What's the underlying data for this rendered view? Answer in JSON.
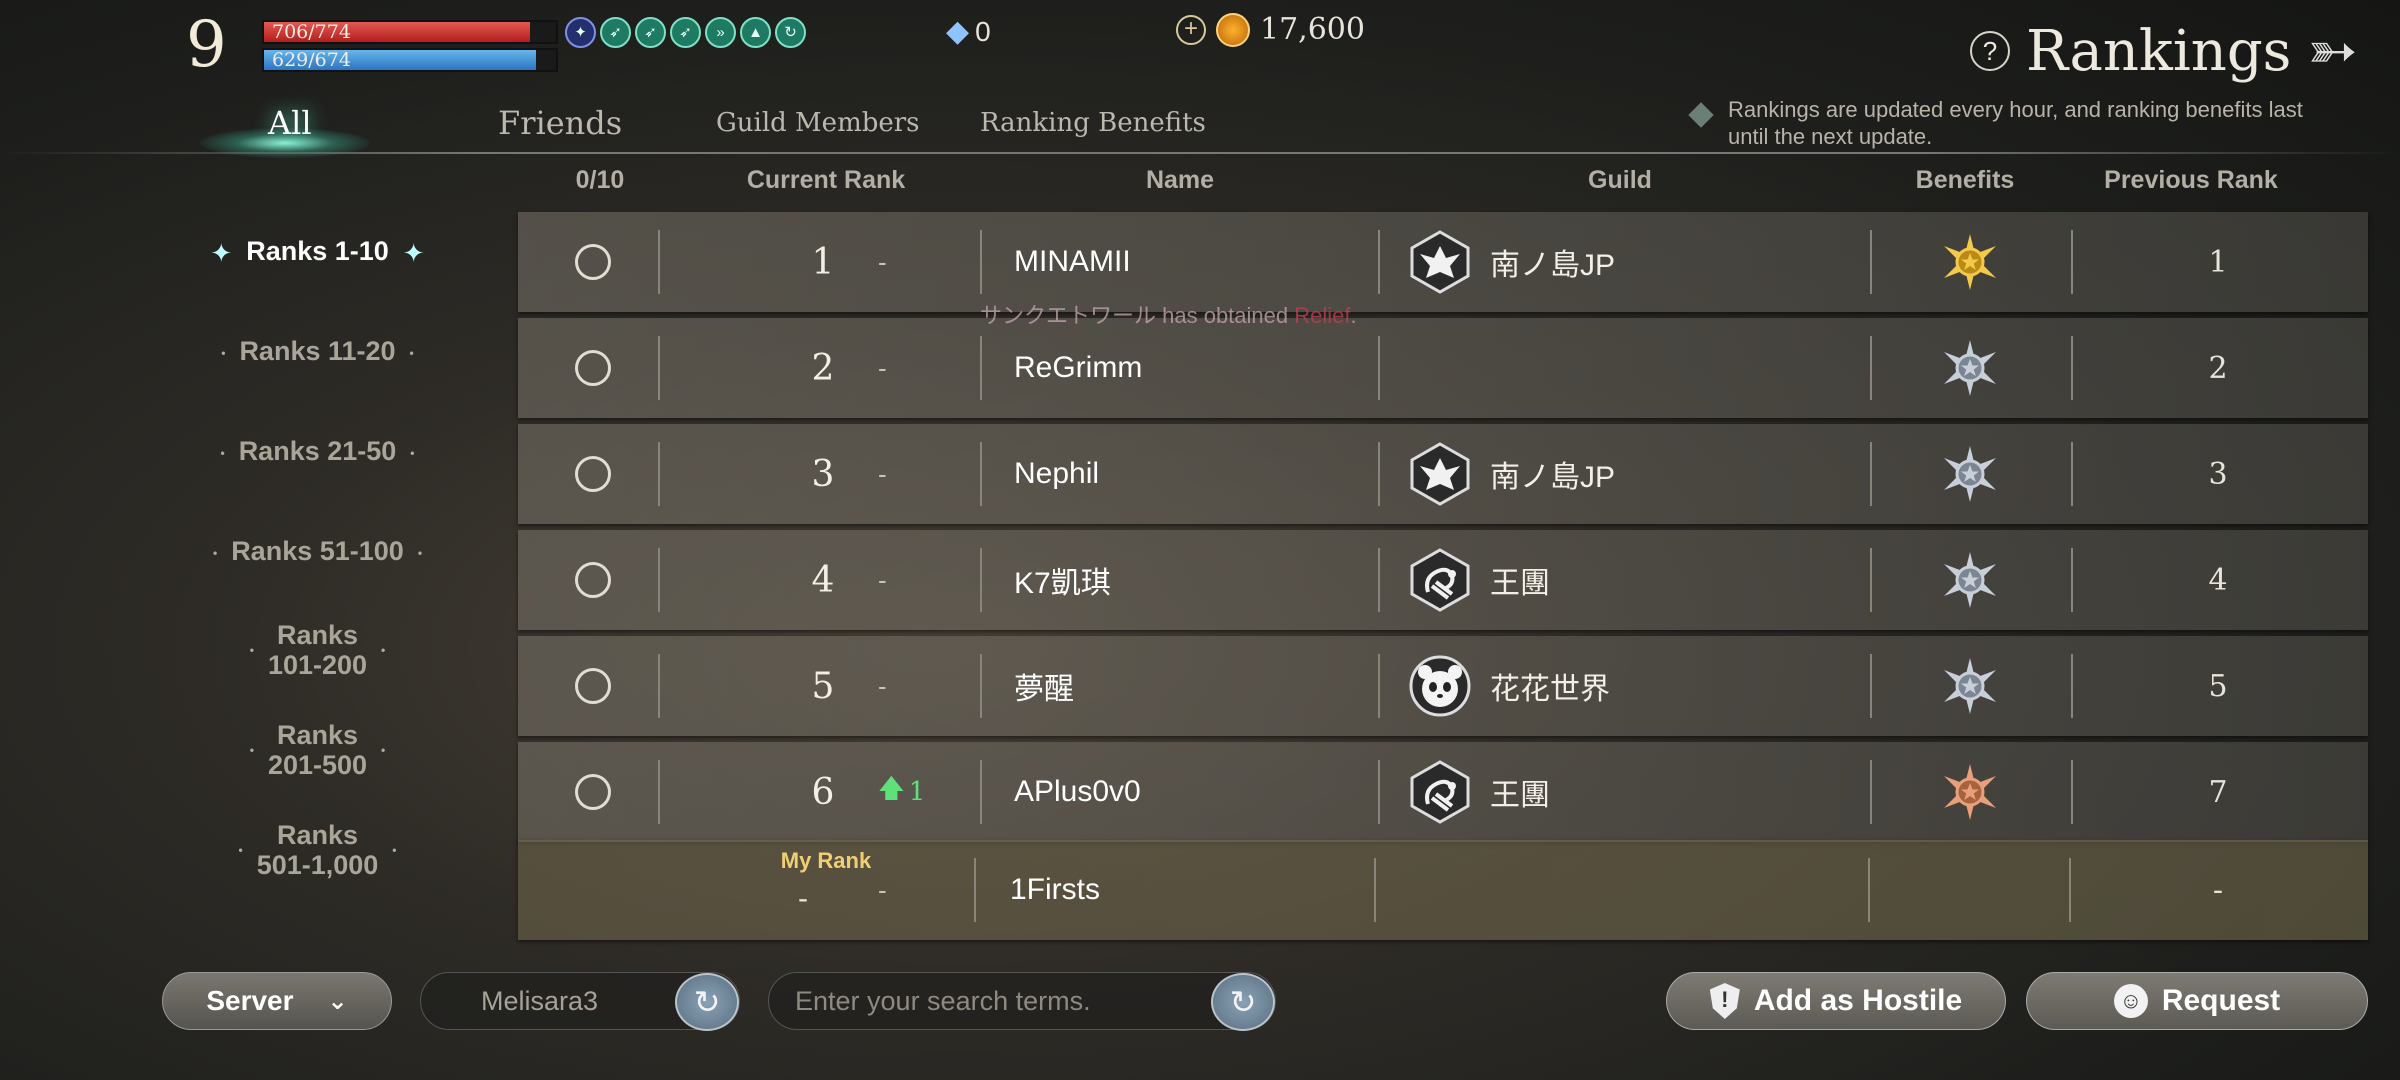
{
  "player": {
    "level": "9",
    "hp": "706/774",
    "mp": "629/674",
    "hp_ratio": 0.91,
    "mp_ratio": 0.93
  },
  "currency": {
    "gems": "0",
    "gold": "17,600"
  },
  "header": {
    "title": "Rankings"
  },
  "tabs": [
    {
      "label": "All",
      "active": true
    },
    {
      "label": "Friends"
    },
    {
      "label": "Guild Members"
    },
    {
      "label": "Ranking Benefits"
    }
  ],
  "notice": "Rankings are updated every hour, and ranking benefits last until the next update.",
  "nav": [
    {
      "label": "Ranks 1-10",
      "active": true
    },
    {
      "label": "Ranks 11-20"
    },
    {
      "label": "Ranks 21-50"
    },
    {
      "label": "Ranks 51-100"
    },
    {
      "label": "Ranks\n101-200"
    },
    {
      "label": "Ranks\n201-500"
    },
    {
      "label": "Ranks\n501-1,000"
    }
  ],
  "columns": {
    "selected": "0/10",
    "current_rank": "Current Rank",
    "name": "Name",
    "guild": "Guild",
    "benefits": "Benefits",
    "previous_rank": "Previous Rank"
  },
  "rows": [
    {
      "rank": "1",
      "change": "-",
      "name": "MINAMII",
      "guild": "南ノ島JP",
      "emblem": "eagle",
      "benefit": "gold",
      "prev": "1"
    },
    {
      "rank": "2",
      "change": "-",
      "name": "ReGrimm",
      "guild": "",
      "emblem": "",
      "benefit": "silver",
      "prev": "2"
    },
    {
      "rank": "3",
      "change": "-",
      "name": "Nephil",
      "guild": "南ノ島JP",
      "emblem": "eagle",
      "benefit": "silver",
      "prev": "3"
    },
    {
      "rank": "4",
      "change": "-",
      "name": "K7凱琪",
      "guild": "王團",
      "emblem": "scorpion",
      "benefit": "silver",
      "prev": "4"
    },
    {
      "rank": "5",
      "change": "-",
      "name": "夢醒",
      "guild": "花花世界",
      "emblem": "panda",
      "benefit": "silver",
      "prev": "5"
    },
    {
      "rank": "6",
      "change": "1",
      "change_up": true,
      "name": "APlus0v0",
      "guild": "王團",
      "emblem": "scorpion",
      "benefit": "bronze",
      "prev": "7"
    }
  ],
  "my_rank": {
    "label": "My Rank",
    "rank": "-",
    "change": "-",
    "name": "1Firsts",
    "prev": "-"
  },
  "ticker": {
    "player": "サンクエトワール",
    "text": " has obtained ",
    "item": "Relief",
    "end": "."
  },
  "bottom": {
    "server_label": "Server",
    "server_value": "Melisara3",
    "search_placeholder": "Enter your search terms.",
    "hostile_label": "Add as Hostile",
    "request_label": "Request"
  }
}
